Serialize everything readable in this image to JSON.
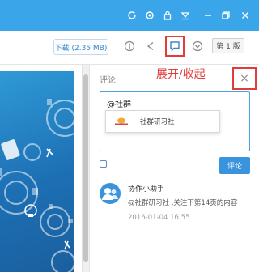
{
  "colors": {
    "titlebar": "#3aa5e8",
    "annotation": "#e23b3b",
    "accent": "#3a93dd",
    "doc_blue": "#1d6fb4"
  },
  "titlebar": {
    "icons": [
      "refresh-icon",
      "settings-icon",
      "lock-icon",
      "dropdown-icon",
      "minimize-icon",
      "restore-icon",
      "close-icon"
    ]
  },
  "toolbar": {
    "download_label": "下载 (2.35 MB)",
    "icons": [
      "info-icon",
      "share-icon",
      "comment-icon",
      "chevron-down-icon"
    ],
    "version_label": "第 1 版"
  },
  "panel": {
    "title": "评论",
    "annotation": "展开/收起",
    "close_symbol": "×",
    "input_value": "@社群",
    "mention_suggestion": "社群研习社",
    "submit_label": "评论",
    "comments": [
      {
        "author": "协作小助手",
        "text": "@社群研习社 ,关注下第14页的内容",
        "time": "2016-01-04 16:55"
      }
    ]
  }
}
